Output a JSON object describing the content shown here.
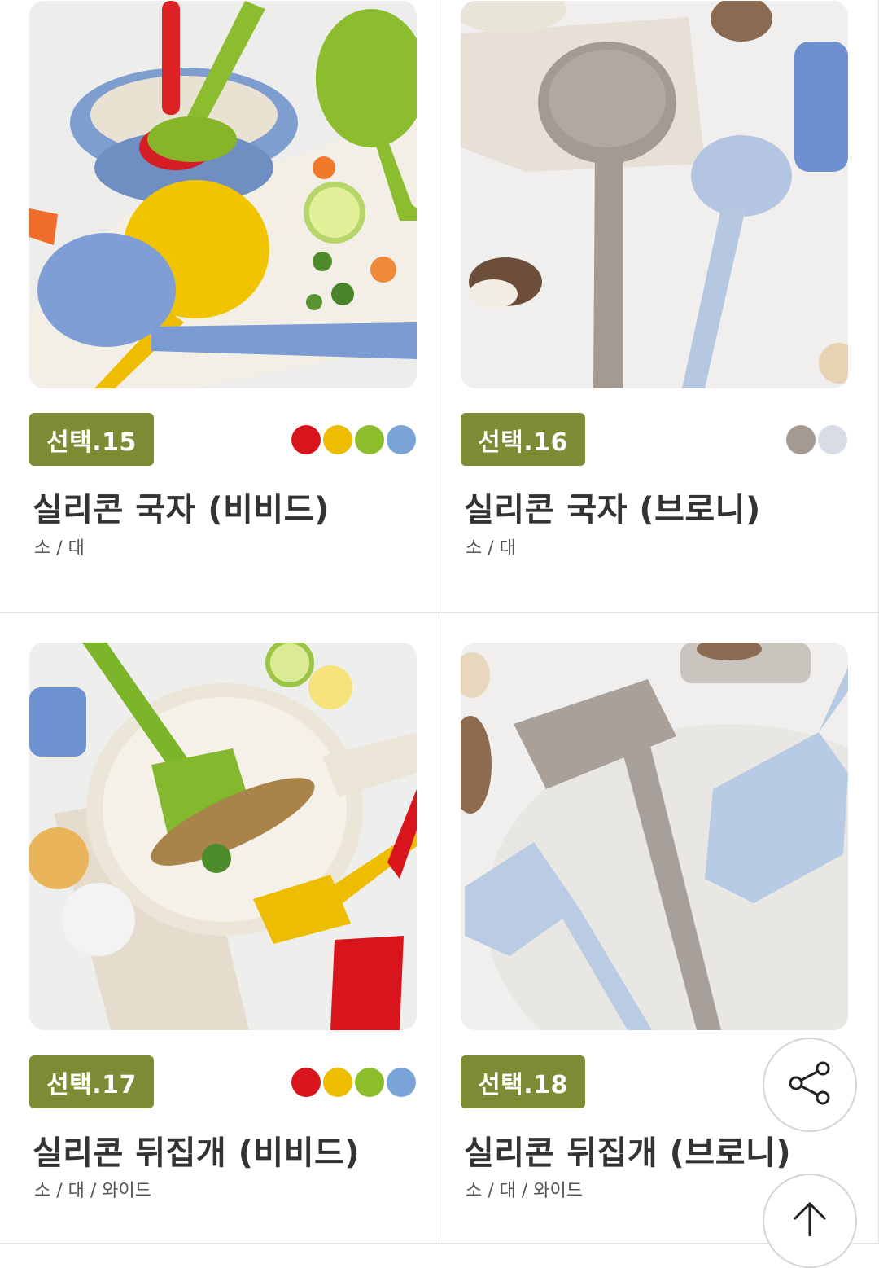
{
  "products": [
    {
      "badge": "선택.15",
      "title": "실리콘 국자 (비비드)",
      "sizes": "소 / 대",
      "colors": [
        "#d8141c",
        "#eebc00",
        "#8cbd2a",
        "#7aa4d8"
      ]
    },
    {
      "badge": "선택.16",
      "title": "실리콘 국자 (브로니)",
      "sizes": "소 / 대",
      "colors": [
        "#a69b92",
        "#d8dde5"
      ]
    },
    {
      "badge": "선택.17",
      "title": "실리콘 뒤집개 (비비드)",
      "sizes": "소 / 대 / 와이드",
      "colors": [
        "#d8141c",
        "#eebc00",
        "#8cbd2a",
        "#7aa4d8"
      ]
    },
    {
      "badge": "선택.18",
      "title": "실리콘 뒤집개 (브로니)",
      "sizes": "소 / 대 / 와이드",
      "colors": []
    }
  ],
  "floating": {
    "share_icon": "share-icon",
    "top_icon": "arrow-up-icon"
  }
}
